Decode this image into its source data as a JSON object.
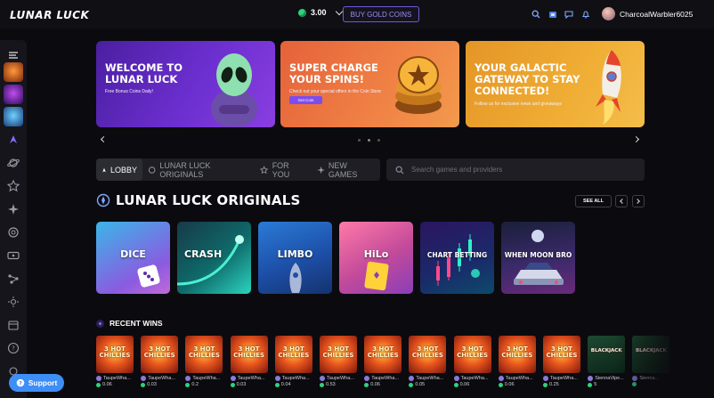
{
  "app": {
    "logo": "LUNAR LUCK"
  },
  "header": {
    "balance": "3.00",
    "buy_button": "BUY GOLD COINS",
    "username": "CharcoalWarbler6025"
  },
  "banners": [
    {
      "title": "WELCOME TO LUNAR LUCK",
      "subtitle": "Free Bonus Coins Daily!"
    },
    {
      "title": "SUPER CHARGE YOUR SPINS!",
      "subtitle": "Check out your special offers in the Coin Store",
      "button": "Get Coin"
    },
    {
      "title": "YOUR GALACTIC GATEWAY TO STAY CONNECTED!",
      "subtitle": "Follow us for exclusive news and giveaways"
    }
  ],
  "tabs": [
    {
      "label": "LOBBY",
      "icon": "rocket-icon",
      "active": true
    },
    {
      "label": "LUNAR LUCK ORIGINALS",
      "icon": "planet-icon"
    },
    {
      "label": "FOR YOU",
      "icon": "star-icon"
    },
    {
      "label": "NEW GAMES",
      "icon": "sparkle-icon"
    }
  ],
  "search": {
    "placeholder": "Search games and providers"
  },
  "originals": {
    "title": "LUNAR LUCK ORIGINALS",
    "see_all": "SEE ALL",
    "games": [
      {
        "name": "DICE"
      },
      {
        "name": "CRASH"
      },
      {
        "name": "LIMBO"
      },
      {
        "name": "HiLo"
      },
      {
        "name": "CHART BETTING"
      },
      {
        "name": "WHEN MOON BRO"
      }
    ]
  },
  "recent_wins": {
    "title": "RECENT WINS",
    "items": [
      {
        "user": "TaupeWha...",
        "amount": "0.06",
        "game": "3 HOT CHILLIES"
      },
      {
        "user": "TaupeWha...",
        "amount": "0.03",
        "game": "3 HOT CHILLIES"
      },
      {
        "user": "TaupeWha...",
        "amount": "0.2",
        "game": "3 HOT CHILLIES"
      },
      {
        "user": "TaupeWha...",
        "amount": "0.03",
        "game": "3 HOT CHILLIES"
      },
      {
        "user": "TaupeWha...",
        "amount": "0.04",
        "game": "3 HOT CHILLIES"
      },
      {
        "user": "TaupeWha...",
        "amount": "0.53",
        "game": "3 HOT CHILLIES"
      },
      {
        "user": "TaupeWha...",
        "amount": "0.06",
        "game": "3 HOT CHILLIES"
      },
      {
        "user": "TaupeWha...",
        "amount": "0.05",
        "game": "3 HOT CHILLIES"
      },
      {
        "user": "TaupeWha...",
        "amount": "0.06",
        "game": "3 HOT CHILLIES"
      },
      {
        "user": "TaupeWha...",
        "amount": "0.06",
        "game": "3 HOT CHILLIES"
      },
      {
        "user": "TaupeWha...",
        "amount": "0.25",
        "game": "3 HOT CHILLIES"
      },
      {
        "user": "SiennaVipe...",
        "amount": "5",
        "game": "BLACKJACK"
      },
      {
        "user": "Sienna...",
        "amount": "",
        "game": "BLACKJACK"
      }
    ]
  },
  "support": {
    "label": "Support"
  },
  "colors": {
    "accent": "#7b4df0",
    "coin": "#2ed37d",
    "support": "#3e8ef7"
  }
}
